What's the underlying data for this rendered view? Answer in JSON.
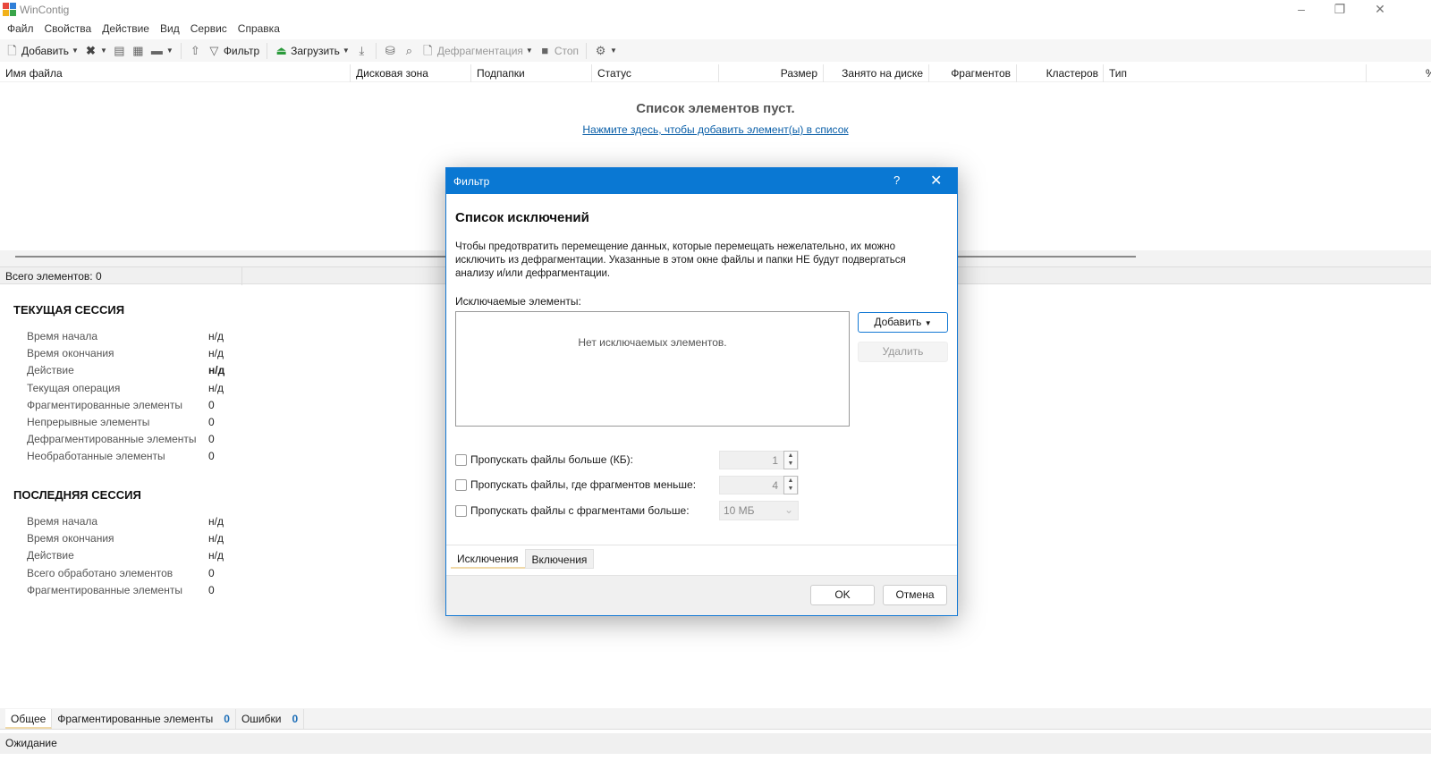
{
  "window": {
    "title": "WinContig",
    "colors": {
      "accent": "#0a78d3",
      "link": "#0a5fa8",
      "badge": "#1e6fb8"
    }
  },
  "menu": [
    "Файл",
    "Свойства",
    "Действие",
    "Вид",
    "Сервис",
    "Справка"
  ],
  "toolbar": {
    "add": "Добавить",
    "filter": "Фильтр",
    "load": "Загрузить",
    "defrag": "Дефрагментация",
    "stop": "Стоп"
  },
  "columns": [
    "Имя файла",
    "Дисковая зона",
    "Подпапки",
    "Статус",
    "Размер",
    "Занято на диске",
    "Фрагментов",
    "Кластеров",
    "Тип",
    "%"
  ],
  "list": {
    "empty_title": "Список элементов пуст.",
    "empty_link": "Нажмите здесь, чтобы добавить элемент(ы) в список"
  },
  "total": "Всего элементов:  0",
  "current_session": {
    "title": "ТЕКУЩАЯ СЕССИЯ",
    "rows": [
      {
        "k": "Время начала",
        "v": "н/д"
      },
      {
        "k": "Время окончания",
        "v": "н/д"
      },
      {
        "k": "Действие",
        "v": "н/д"
      },
      {
        "k": "Текущая операция",
        "v": "н/д"
      },
      {
        "k": "Фрагментированные элементы",
        "v": "0"
      },
      {
        "k": "Непрерывные элементы",
        "v": "0"
      },
      {
        "k": "Дефрагментированные элементы",
        "v": "0"
      },
      {
        "k": "Необработанные элементы",
        "v": "0"
      }
    ]
  },
  "last_session": {
    "title": "ПОСЛЕДНЯЯ СЕССИЯ",
    "rows": [
      {
        "k": "Время начала",
        "v": "н/д"
      },
      {
        "k": "Время окончания",
        "v": "н/д"
      },
      {
        "k": "Действие",
        "v": "н/д"
      },
      {
        "k": "Всего обработано элементов",
        "v": "0"
      },
      {
        "k": "Фрагментированные элементы",
        "v": "0"
      }
    ]
  },
  "bottom_tabs": [
    {
      "label": "Общее"
    },
    {
      "label": "Фрагментированные элементы",
      "count": "0"
    },
    {
      "label": "Ошибки",
      "count": "0"
    }
  ],
  "status": "Ожидание",
  "dialog": {
    "title": "Фильтр",
    "help": "?",
    "heading": "Список исключений",
    "description": "Чтобы предотвратить перемещение данных, которые перемещать нежелательно, их можно исключить из дефрагментации. Указанные в этом окне файлы и папки НЕ будут подвергаться анализу и/или дефрагментации.",
    "excluded_label": "Исключаемые элементы:",
    "excluded_empty": "Нет исключаемых элементов.",
    "add": "Добавить",
    "remove": "Удалить",
    "options": [
      {
        "label": "Пропускать файлы больше (КБ):",
        "value": "1"
      },
      {
        "label": "Пропускать файлы, где фрагментов меньше:",
        "value": "4"
      },
      {
        "label": "Пропускать файлы с фрагментами больше:",
        "value": "10 МБ"
      }
    ],
    "tabs": [
      "Исключения",
      "Включения"
    ],
    "ok": "OK",
    "cancel": "Отмена"
  }
}
